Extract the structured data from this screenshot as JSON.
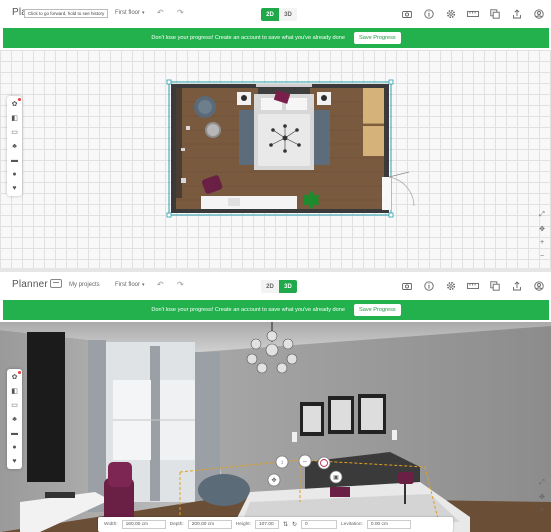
{
  "app": {
    "name": "Planner",
    "my_projects": "My projects",
    "floor": "First floor",
    "tooltip": "Click to go forward, hold to see history",
    "view_2d": "2D",
    "view_3d": "3D",
    "banner_text": "Don't lose your progress! Create an account to save what you've already done",
    "save_label": "Save Progress"
  },
  "toolbar_icons": [
    "camera-icon",
    "info-icon",
    "settings-icon",
    "measure-icon",
    "copy-icon",
    "share-icon",
    "account-icon"
  ],
  "left_tools": [
    "build-icon",
    "door-icon",
    "furniture-icon",
    "plant-icon",
    "tv-icon",
    "color-icon",
    "heart-icon"
  ],
  "right_tools": [
    "fullscreen-icon",
    "compass-icon",
    "zoom-in-icon",
    "zoom-out-icon"
  ],
  "dimensions": {
    "width_label": "Width:",
    "width_value": "160.00 cm",
    "depth_label": "Depth:",
    "depth_value": "200.00 cm",
    "height_label": "Height:",
    "height_value": "107.00",
    "rotate_value": "0",
    "levitation_label": "Levitation:",
    "levitation_value": "0.00 cm"
  },
  "colors": {
    "accent": "#22b14c",
    "floor": "#7a5a3e",
    "sofa": "#5c6c7a",
    "accent_chair": "#6a1f45"
  }
}
